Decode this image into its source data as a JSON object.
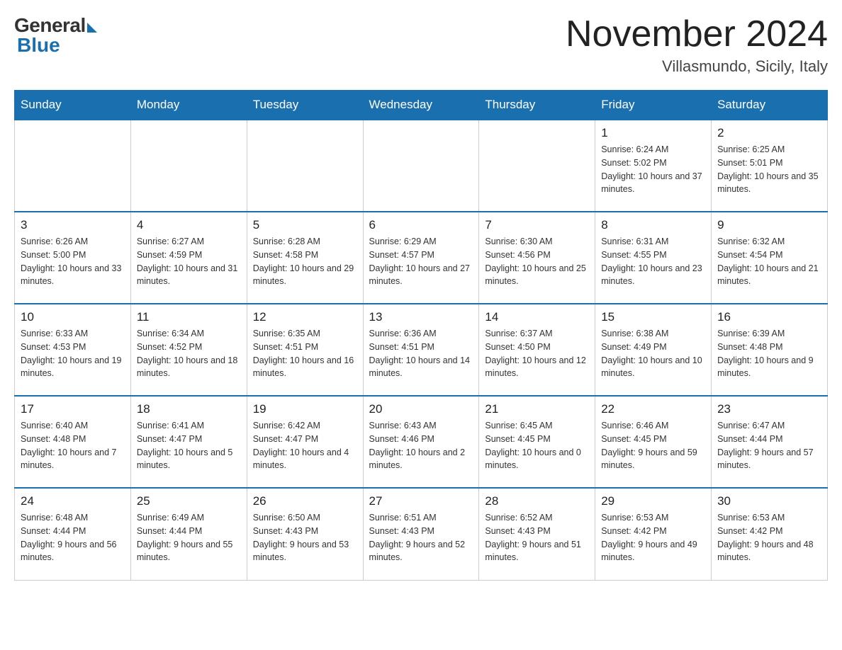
{
  "header": {
    "logo_general": "General",
    "logo_blue": "Blue",
    "month_title": "November 2024",
    "location": "Villasmundo, Sicily, Italy"
  },
  "weekdays": [
    "Sunday",
    "Monday",
    "Tuesday",
    "Wednesday",
    "Thursday",
    "Friday",
    "Saturday"
  ],
  "weeks": [
    [
      {
        "day": "",
        "info": ""
      },
      {
        "day": "",
        "info": ""
      },
      {
        "day": "",
        "info": ""
      },
      {
        "day": "",
        "info": ""
      },
      {
        "day": "",
        "info": ""
      },
      {
        "day": "1",
        "info": "Sunrise: 6:24 AM\nSunset: 5:02 PM\nDaylight: 10 hours and 37 minutes."
      },
      {
        "day": "2",
        "info": "Sunrise: 6:25 AM\nSunset: 5:01 PM\nDaylight: 10 hours and 35 minutes."
      }
    ],
    [
      {
        "day": "3",
        "info": "Sunrise: 6:26 AM\nSunset: 5:00 PM\nDaylight: 10 hours and 33 minutes."
      },
      {
        "day": "4",
        "info": "Sunrise: 6:27 AM\nSunset: 4:59 PM\nDaylight: 10 hours and 31 minutes."
      },
      {
        "day": "5",
        "info": "Sunrise: 6:28 AM\nSunset: 4:58 PM\nDaylight: 10 hours and 29 minutes."
      },
      {
        "day": "6",
        "info": "Sunrise: 6:29 AM\nSunset: 4:57 PM\nDaylight: 10 hours and 27 minutes."
      },
      {
        "day": "7",
        "info": "Sunrise: 6:30 AM\nSunset: 4:56 PM\nDaylight: 10 hours and 25 minutes."
      },
      {
        "day": "8",
        "info": "Sunrise: 6:31 AM\nSunset: 4:55 PM\nDaylight: 10 hours and 23 minutes."
      },
      {
        "day": "9",
        "info": "Sunrise: 6:32 AM\nSunset: 4:54 PM\nDaylight: 10 hours and 21 minutes."
      }
    ],
    [
      {
        "day": "10",
        "info": "Sunrise: 6:33 AM\nSunset: 4:53 PM\nDaylight: 10 hours and 19 minutes."
      },
      {
        "day": "11",
        "info": "Sunrise: 6:34 AM\nSunset: 4:52 PM\nDaylight: 10 hours and 18 minutes."
      },
      {
        "day": "12",
        "info": "Sunrise: 6:35 AM\nSunset: 4:51 PM\nDaylight: 10 hours and 16 minutes."
      },
      {
        "day": "13",
        "info": "Sunrise: 6:36 AM\nSunset: 4:51 PM\nDaylight: 10 hours and 14 minutes."
      },
      {
        "day": "14",
        "info": "Sunrise: 6:37 AM\nSunset: 4:50 PM\nDaylight: 10 hours and 12 minutes."
      },
      {
        "day": "15",
        "info": "Sunrise: 6:38 AM\nSunset: 4:49 PM\nDaylight: 10 hours and 10 minutes."
      },
      {
        "day": "16",
        "info": "Sunrise: 6:39 AM\nSunset: 4:48 PM\nDaylight: 10 hours and 9 minutes."
      }
    ],
    [
      {
        "day": "17",
        "info": "Sunrise: 6:40 AM\nSunset: 4:48 PM\nDaylight: 10 hours and 7 minutes."
      },
      {
        "day": "18",
        "info": "Sunrise: 6:41 AM\nSunset: 4:47 PM\nDaylight: 10 hours and 5 minutes."
      },
      {
        "day": "19",
        "info": "Sunrise: 6:42 AM\nSunset: 4:47 PM\nDaylight: 10 hours and 4 minutes."
      },
      {
        "day": "20",
        "info": "Sunrise: 6:43 AM\nSunset: 4:46 PM\nDaylight: 10 hours and 2 minutes."
      },
      {
        "day": "21",
        "info": "Sunrise: 6:45 AM\nSunset: 4:45 PM\nDaylight: 10 hours and 0 minutes."
      },
      {
        "day": "22",
        "info": "Sunrise: 6:46 AM\nSunset: 4:45 PM\nDaylight: 9 hours and 59 minutes."
      },
      {
        "day": "23",
        "info": "Sunrise: 6:47 AM\nSunset: 4:44 PM\nDaylight: 9 hours and 57 minutes."
      }
    ],
    [
      {
        "day": "24",
        "info": "Sunrise: 6:48 AM\nSunset: 4:44 PM\nDaylight: 9 hours and 56 minutes."
      },
      {
        "day": "25",
        "info": "Sunrise: 6:49 AM\nSunset: 4:44 PM\nDaylight: 9 hours and 55 minutes."
      },
      {
        "day": "26",
        "info": "Sunrise: 6:50 AM\nSunset: 4:43 PM\nDaylight: 9 hours and 53 minutes."
      },
      {
        "day": "27",
        "info": "Sunrise: 6:51 AM\nSunset: 4:43 PM\nDaylight: 9 hours and 52 minutes."
      },
      {
        "day": "28",
        "info": "Sunrise: 6:52 AM\nSunset: 4:43 PM\nDaylight: 9 hours and 51 minutes."
      },
      {
        "day": "29",
        "info": "Sunrise: 6:53 AM\nSunset: 4:42 PM\nDaylight: 9 hours and 49 minutes."
      },
      {
        "day": "30",
        "info": "Sunrise: 6:53 AM\nSunset: 4:42 PM\nDaylight: 9 hours and 48 minutes."
      }
    ]
  ]
}
